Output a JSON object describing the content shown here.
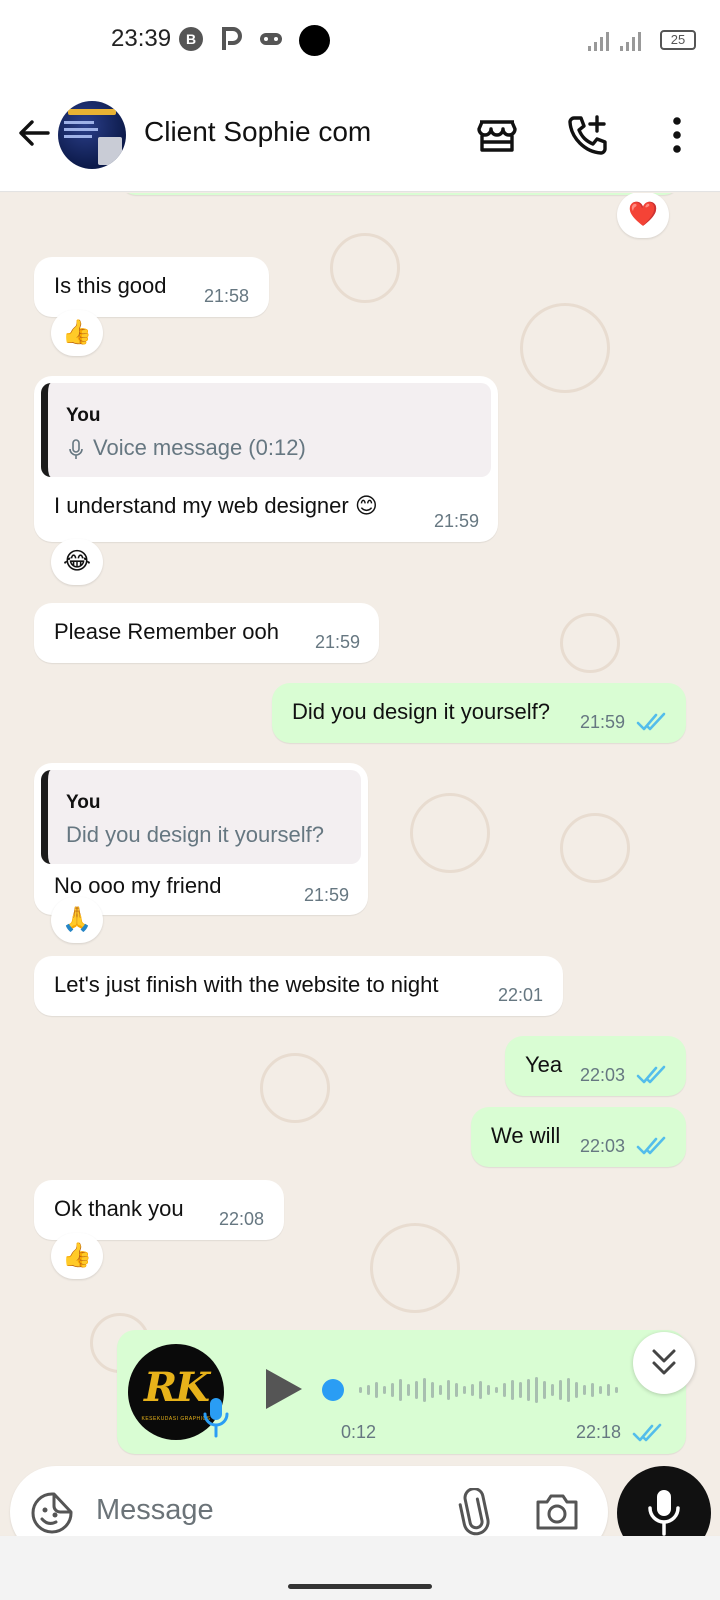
{
  "status_bar": {
    "time": "23:39",
    "icons": [
      "b-circle-icon",
      "p-icon",
      "gamepad-icon"
    ],
    "battery": "25"
  },
  "header": {
    "contact_name": "Client Sophie com",
    "icons": [
      "back-arrow-icon",
      "store-icon",
      "add-call-icon",
      "more-vert-icon"
    ]
  },
  "messages": [
    {
      "type": "reaction_only",
      "reaction": "❤️"
    },
    {
      "type": "incoming",
      "text": "Is this good",
      "time": "21:58",
      "reaction": "👍"
    },
    {
      "type": "incoming",
      "quote": {
        "author": "You",
        "text": "Voice message (0:12)"
      },
      "text": "I understand my web designer 😊",
      "time": "21:59",
      "reaction": "😂"
    },
    {
      "type": "incoming",
      "text": "Please Remember ooh",
      "time": "21:59"
    },
    {
      "type": "outgoing",
      "text": "Did you design it yourself?",
      "time": "21:59",
      "status": "read"
    },
    {
      "type": "incoming",
      "quote": {
        "author": "You",
        "text": "Did you design it yourself?"
      },
      "text": "No ooo my friend",
      "time": "21:59",
      "reaction": "🙏"
    },
    {
      "type": "incoming",
      "text": "Let's just finish with the website to night",
      "time": "22:01"
    },
    {
      "type": "outgoing",
      "text": "Yea",
      "time": "22:03",
      "status": "read"
    },
    {
      "type": "outgoing",
      "text": "We will",
      "time": "22:03",
      "status": "read"
    },
    {
      "type": "incoming",
      "text": "Ok thank you",
      "time": "22:08",
      "reaction": "👍"
    },
    {
      "type": "outgoing_voice",
      "avatar_text": "RK",
      "avatar_subtext": "KESEKUDASI GRAPHICS",
      "duration": "0:12",
      "time": "22:18",
      "status": "read",
      "progress": 0
    }
  ],
  "input": {
    "placeholder": "Message",
    "icons": [
      "sticker-icon",
      "attach-icon",
      "camera-icon",
      "mic-icon"
    ]
  },
  "colors": {
    "incoming_bubble": "#ffffff",
    "outgoing_bubble": "#d9fdd3",
    "read_ticks": "#53bdeb",
    "chat_background": "#f3ede6"
  }
}
